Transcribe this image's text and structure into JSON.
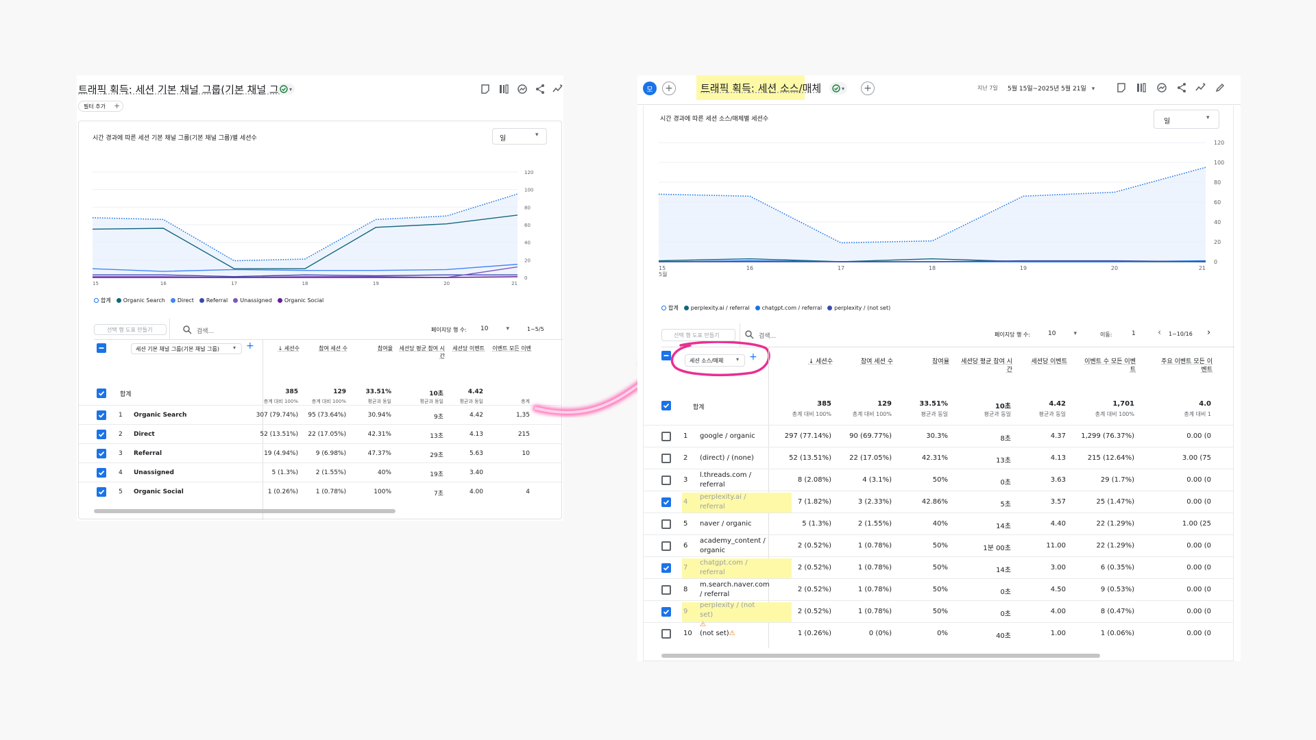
{
  "left": {
    "title": "트래픽 획득: 세션 기본 채널 그룹(기본 채널 그룹)",
    "filter_label": "필터 추가",
    "chart_title": "시간 경과에 따른 세션 기본 채널 그룹(기본 채널 그룹)별 세션수",
    "granularity": "일",
    "search_placeholder": "검색...",
    "create_chart_label": "선택 행 도표 만들기",
    "rows_per_page_label": "페이지당 행 수:",
    "rows_per_page": "10",
    "page_range": "1~5/5",
    "dimension_header": "세션 기본 채널 그룹(기본 채널 그룹)",
    "columns": [
      "↓ 세션수",
      "참여 세션 수",
      "참여율",
      "세션당 평균 참여 시간",
      "세션당 이벤트",
      "이벤트 모든 이벤"
    ],
    "totals_label": "합계",
    "totals": [
      {
        "value": "385",
        "sub": "총계 대비 100%"
      },
      {
        "value": "129",
        "sub": "총계 대비 100%"
      },
      {
        "value": "33.51%",
        "sub": "평균과 동일"
      },
      {
        "value": "10초",
        "sub": "평균과 동일"
      },
      {
        "value": "4.42",
        "sub": "평균과 동일"
      },
      {
        "value": "",
        "sub": "총계"
      }
    ],
    "rows": [
      {
        "n": "1",
        "name": "Organic Search",
        "c": [
          "307 (79.74%)",
          "95 (73.64%)",
          "30.94%",
          "9초",
          "4.42",
          "1,35"
        ]
      },
      {
        "n": "2",
        "name": "Direct",
        "c": [
          "52 (13.51%)",
          "22 (17.05%)",
          "42.31%",
          "13초",
          "4.13",
          "215"
        ]
      },
      {
        "n": "3",
        "name": "Referral",
        "c": [
          "19 (4.94%)",
          "9 (6.98%)",
          "47.37%",
          "29초",
          "5.63",
          "10"
        ]
      },
      {
        "n": "4",
        "name": "Unassigned",
        "c": [
          "5 (1.3%)",
          "2 (1.55%)",
          "40%",
          "19초",
          "3.40",
          ""
        ]
      },
      {
        "n": "5",
        "name": "Organic Social",
        "c": [
          "1 (0.26%)",
          "1 (0.78%)",
          "100%",
          "7초",
          "4.00",
          "4"
        ]
      }
    ],
    "chart_data": {
      "type": "line",
      "x": [
        "15 5월",
        "16",
        "17",
        "18",
        "19",
        "20",
        "21"
      ],
      "ylim": [
        0,
        120
      ],
      "yticks": [
        "0",
        "20",
        "40",
        "60",
        "80",
        "100",
        "120"
      ],
      "legend": [
        "합계",
        "Organic Search",
        "Direct",
        "Referral",
        "Unassigned",
        "Organic Social"
      ],
      "series": [
        {
          "name": "합계",
          "color": "#1a73e8",
          "style": "dotted",
          "values": [
            68,
            66,
            19,
            21,
            66,
            70,
            95
          ]
        },
        {
          "name": "Organic Search",
          "color": "#12677e",
          "values": [
            55,
            56,
            10,
            10,
            57,
            61,
            71
          ]
        },
        {
          "name": "Direct",
          "color": "#4285f4",
          "values": [
            10,
            7,
            9,
            8,
            8,
            9,
            15
          ]
        },
        {
          "name": "Referral",
          "color": "#3949ab",
          "values": [
            3,
            3,
            1,
            3,
            2,
            3,
            3
          ]
        },
        {
          "name": "Unassigned",
          "color": "#7e57c2",
          "values": [
            1,
            1,
            0,
            1,
            1,
            0,
            12
          ]
        },
        {
          "name": "Organic Social",
          "color": "#6a1b9a",
          "values": [
            0,
            0,
            0,
            0,
            0,
            0,
            1
          ]
        }
      ]
    }
  },
  "right": {
    "avatar": "모",
    "title": "트래픽 획득: 세션 소스/매체",
    "date_label": "지난 7일",
    "date_range": "5월 15일~2025년 5월 21일",
    "chart_title": "시간 경과에 따른 세션 소스/매체별 세션수",
    "granularity": "일",
    "search_placeholder": "검색...",
    "create_chart_label": "선택 행 도표 만들기",
    "rows_per_page_label": "페이지당 행 수:",
    "rows_per_page": "10",
    "goto_label": "이동:",
    "goto_value": "1",
    "page_range": "1~10/16",
    "dimension_header": "세션 소스/매체",
    "columns": [
      "↓ 세션수",
      "참여 세션 수",
      "참여율",
      "세션당 평균 참여 시간",
      "세션당 이벤트",
      "이벤트 수 모든 이벤트",
      "주요 이벤트 모든 이벤트"
    ],
    "totals_label": "합계",
    "totals": [
      {
        "value": "385",
        "sub": "총계 대비 100%"
      },
      {
        "value": "129",
        "sub": "총계 대비 100%"
      },
      {
        "value": "33.51%",
        "sub": "평균과 동일"
      },
      {
        "value": "10초",
        "sub": "평균과 동일"
      },
      {
        "value": "4.42",
        "sub": "평균과 동일"
      },
      {
        "value": "1,701",
        "sub": "총계 대비 100%"
      },
      {
        "value": "4.0",
        "sub": "총계 대비 1"
      }
    ],
    "rows": [
      {
        "n": "1",
        "name": "google / organic",
        "checked": false,
        "hl": false,
        "warn": false,
        "c": [
          "297 (77.14%)",
          "90 (69.77%)",
          "30.3%",
          "8초",
          "4.37",
          "1,299 (76.37%)",
          "0.00 (0"
        ]
      },
      {
        "n": "2",
        "name": "(direct) / (none)",
        "checked": false,
        "hl": false,
        "warn": false,
        "c": [
          "52 (13.51%)",
          "22 (17.05%)",
          "42.31%",
          "13초",
          "4.13",
          "215 (12.64%)",
          "3.00 (75"
        ]
      },
      {
        "n": "3",
        "name": "l.threads.com / referral",
        "checked": false,
        "hl": false,
        "warn": false,
        "c": [
          "8 (2.08%)",
          "4 (3.1%)",
          "50%",
          "0초",
          "3.63",
          "29 (1.7%)",
          "0.00 (0"
        ]
      },
      {
        "n": "4",
        "name": "perplexity.ai / referral",
        "checked": true,
        "hl": true,
        "warn": false,
        "c": [
          "7 (1.82%)",
          "3 (2.33%)",
          "42.86%",
          "5초",
          "3.57",
          "25 (1.47%)",
          "0.00 (0"
        ]
      },
      {
        "n": "5",
        "name": "naver / organic",
        "checked": false,
        "hl": false,
        "warn": false,
        "c": [
          "5 (1.3%)",
          "2 (1.55%)",
          "40%",
          "14초",
          "4.40",
          "22 (1.29%)",
          "1.00 (25"
        ]
      },
      {
        "n": "6",
        "name": "academy_content / organic",
        "checked": false,
        "hl": false,
        "warn": false,
        "c": [
          "2 (0.52%)",
          "1 (0.78%)",
          "50%",
          "1분 00초",
          "11.00",
          "22 (1.29%)",
          "0.00 (0"
        ]
      },
      {
        "n": "7",
        "name": "chatgpt.com / referral",
        "checked": true,
        "hl": true,
        "warn": false,
        "c": [
          "2 (0.52%)",
          "1 (0.78%)",
          "50%",
          "14초",
          "3.00",
          "6 (0.35%)",
          "0.00 (0"
        ]
      },
      {
        "n": "8",
        "name": "m.search.naver.com / referral",
        "checked": false,
        "hl": false,
        "warn": false,
        "c": [
          "2 (0.52%)",
          "1 (0.78%)",
          "50%",
          "0초",
          "4.50",
          "9 (0.53%)",
          "0.00 (0"
        ]
      },
      {
        "n": "9",
        "name": "perplexity / (not set)",
        "checked": true,
        "hl": true,
        "warn": true,
        "c": [
          "2 (0.52%)",
          "1 (0.78%)",
          "50%",
          "0초",
          "4.00",
          "8 (0.47%)",
          "0.00 (0"
        ]
      },
      {
        "n": "10",
        "name": "(not set)",
        "checked": false,
        "hl": false,
        "warn": true,
        "c": [
          "1 (0.26%)",
          "0 (0%)",
          "0%",
          "40초",
          "1.00",
          "1 (0.06%)",
          "0.00 (0"
        ]
      }
    ],
    "chart_data": {
      "type": "line",
      "x": [
        "15 5월",
        "16",
        "17",
        "18",
        "19",
        "20",
        "21"
      ],
      "ylim": [
        0,
        120
      ],
      "yticks": [
        "0",
        "20",
        "40",
        "60",
        "80",
        "100",
        "120"
      ],
      "legend": [
        "합계",
        "perplexity.ai / referral",
        "chatgpt.com / referral",
        "perplexity / (not set)"
      ],
      "series": [
        {
          "name": "합계",
          "color": "#1a73e8",
          "style": "dotted",
          "values": [
            68,
            66,
            19,
            21,
            66,
            70,
            95
          ]
        },
        {
          "name": "perplexity.ai / referral",
          "color": "#12677e",
          "values": [
            1,
            3,
            0,
            3,
            0,
            0,
            0
          ]
        },
        {
          "name": "chatgpt.com / referral",
          "color": "#1a73e8",
          "values": [
            0,
            1,
            0,
            0,
            0,
            0,
            1
          ]
        },
        {
          "name": "perplexity / (not set)",
          "color": "#3949ab",
          "values": [
            0,
            0,
            0,
            0,
            1,
            1,
            0
          ]
        }
      ]
    }
  }
}
